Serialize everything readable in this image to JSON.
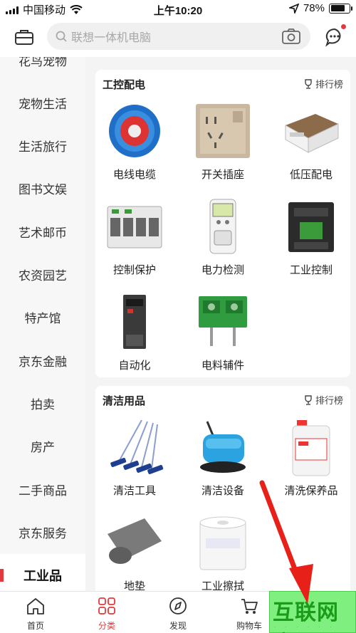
{
  "status": {
    "carrier": "中国移动",
    "time": "上午10:20",
    "battery_pct": "78%",
    "battery_level": 0.78
  },
  "header": {
    "search_placeholder": "联想一体机电脑"
  },
  "sidebar": {
    "items": [
      {
        "label": "花鸟宠物"
      },
      {
        "label": "宠物生活"
      },
      {
        "label": "生活旅行"
      },
      {
        "label": "图书文娱"
      },
      {
        "label": "艺术邮币"
      },
      {
        "label": "农资园艺"
      },
      {
        "label": "特产馆"
      },
      {
        "label": "京东金融"
      },
      {
        "label": "拍卖"
      },
      {
        "label": "房产"
      },
      {
        "label": "二手商品"
      },
      {
        "label": "京东服务"
      },
      {
        "label": "工业品"
      }
    ],
    "active_index": 12
  },
  "sections": [
    {
      "title": "工控配电",
      "rank_label": "排行榜",
      "products": [
        {
          "name": "电线电缆",
          "icon": "cable-reel-icon"
        },
        {
          "name": "开关插座",
          "icon": "wall-socket-icon"
        },
        {
          "name": "低压配电",
          "icon": "distribution-box-icon"
        },
        {
          "name": "控制保护",
          "icon": "circuit-breaker-icon"
        },
        {
          "name": "电力检测",
          "icon": "power-meter-icon"
        },
        {
          "name": "工业控制",
          "icon": "contactor-icon"
        },
        {
          "name": "自动化",
          "icon": "inverter-icon"
        },
        {
          "name": "电料辅件",
          "icon": "terminal-block-icon"
        }
      ]
    },
    {
      "title": "清洁用品",
      "rank_label": "排行榜",
      "products": [
        {
          "name": "清洁工具",
          "icon": "mops-icon"
        },
        {
          "name": "清洁设备",
          "icon": "floor-scrubber-icon"
        },
        {
          "name": "清洗保养品",
          "icon": "cleaner-bottle-icon"
        },
        {
          "name": "地垫",
          "icon": "floor-mat-icon"
        },
        {
          "name": "工业擦拭",
          "icon": "wipes-roll-icon"
        }
      ]
    }
  ],
  "tabbar": {
    "tabs": [
      {
        "label": "首页",
        "icon": "home-icon"
      },
      {
        "label": "分类",
        "icon": "category-icon"
      },
      {
        "label": "发现",
        "icon": "compass-icon"
      },
      {
        "label": "购物车",
        "icon": "cart-icon"
      }
    ],
    "active_index": 1
  },
  "watermark": {
    "text": "互联网应用"
  },
  "colors": {
    "accent": "#e4393c",
    "watermark_green": "#7ff07f",
    "arrow_red": "#e8201a"
  }
}
